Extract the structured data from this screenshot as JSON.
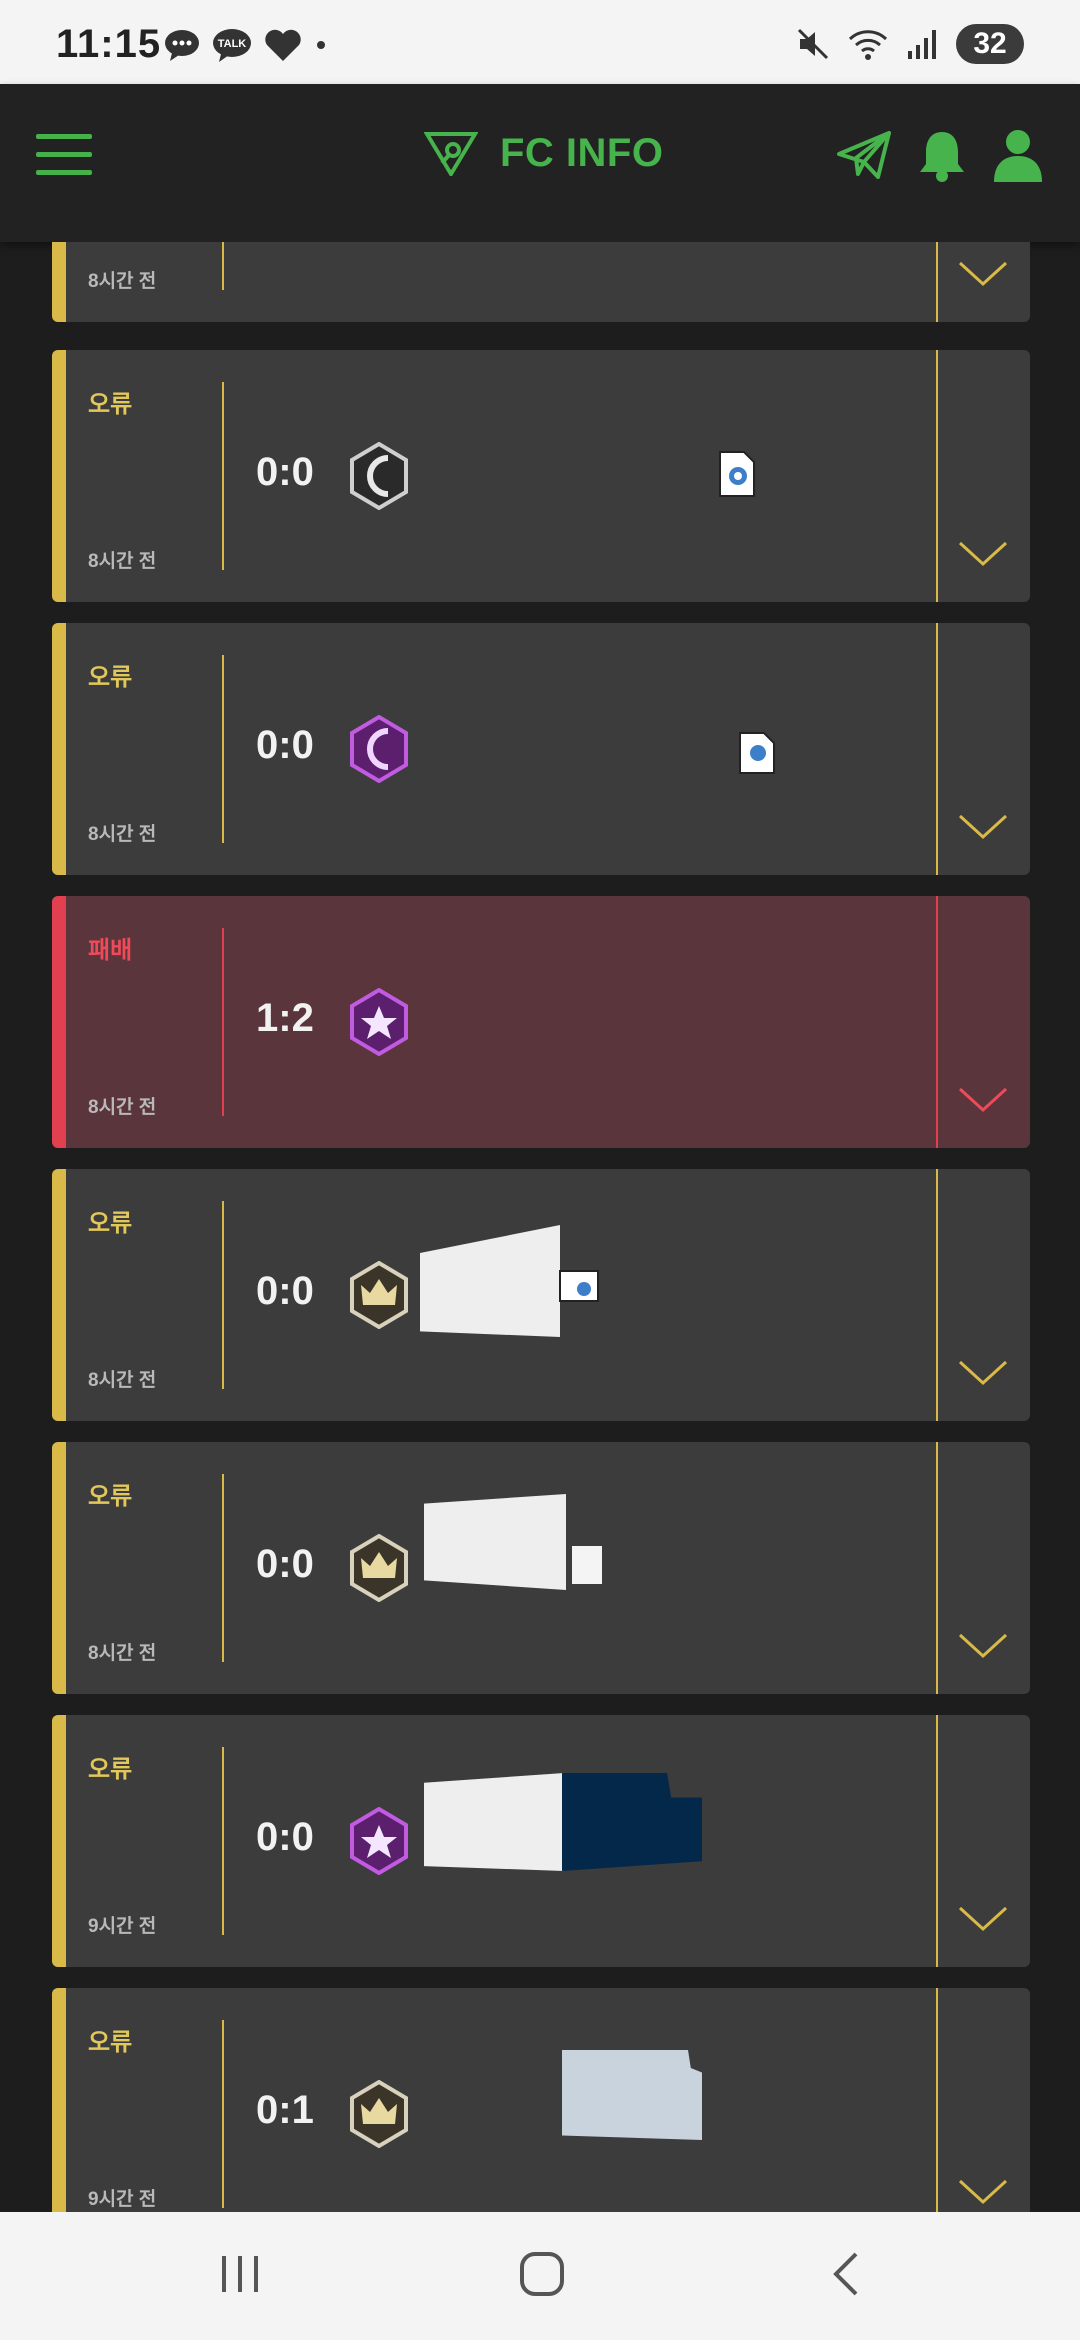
{
  "status_bar": {
    "time": "11:15",
    "notification_icons": [
      "chat-bubble-icon",
      "kakaotalk-icon",
      "heart-icon",
      "dot-icon"
    ],
    "kakaotalk_label": "TALK",
    "battery": "32"
  },
  "header": {
    "title": "FC INFO",
    "accent_color": "#47b34c"
  },
  "matches": [
    {
      "result": "",
      "score": "",
      "time": "8시간 전",
      "badge": "none",
      "status": "error"
    },
    {
      "result": "오류",
      "score": "0:0",
      "time": "8시간 전",
      "badge": "silver-ring",
      "status": "error"
    },
    {
      "result": "오류",
      "score": "0:0",
      "time": "8시간 전",
      "badge": "purple-ring",
      "status": "error"
    },
    {
      "result": "패배",
      "score": "1:2",
      "time": "8시간 전",
      "badge": "purple-star",
      "status": "loss"
    },
    {
      "result": "오류",
      "score": "0:0",
      "time": "8시간 전",
      "badge": "gold-crown",
      "status": "error"
    },
    {
      "result": "오류",
      "score": "0:0",
      "time": "8시간 전",
      "badge": "gold-crown",
      "status": "error"
    },
    {
      "result": "오류",
      "score": "0:0",
      "time": "9시간 전",
      "badge": "purple-star",
      "status": "error"
    },
    {
      "result": "오류",
      "score": "0:1",
      "time": "9시간 전",
      "badge": "gold-crown",
      "status": "error"
    }
  ],
  "colors": {
    "error": "#d9b948",
    "loss": "#e0404f",
    "card": "#3c3c3c",
    "loss_card": "#5a353c"
  }
}
